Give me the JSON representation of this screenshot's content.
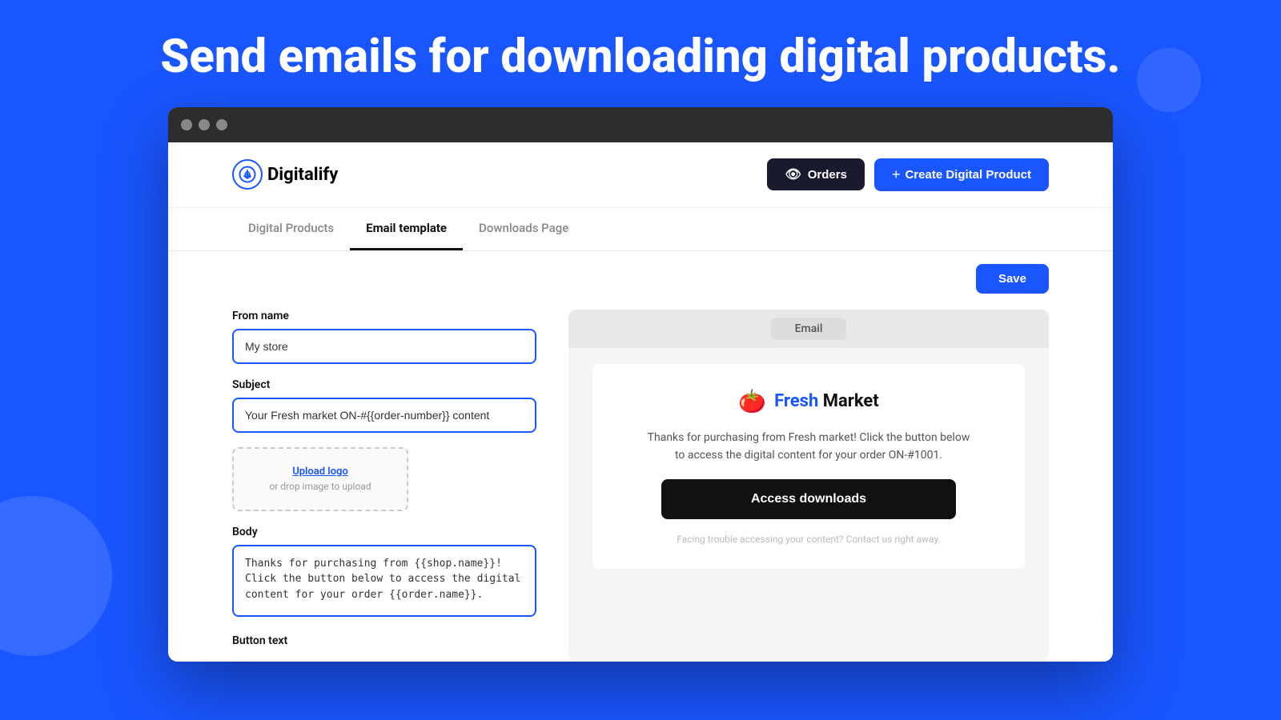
{
  "page": {
    "headline": "Send emails for downloading digital products."
  },
  "browser": {
    "dots": [
      "dot1",
      "dot2",
      "dot3"
    ]
  },
  "header": {
    "logo_text_bold": "Digital",
    "logo_text_light": "ify",
    "orders_button": "Orders",
    "create_button": "Create Digital Product"
  },
  "tabs": [
    {
      "id": "digital-products",
      "label": "Digital Products",
      "active": false
    },
    {
      "id": "email-template",
      "label": "Email template",
      "active": true
    },
    {
      "id": "downloads-page",
      "label": "Downloads Page",
      "active": false
    }
  ],
  "save_button": "Save",
  "form": {
    "from_name_label": "From name",
    "from_name_value": "My store",
    "from_name_placeholder": "My store",
    "subject_label": "Subject",
    "subject_value": "Your Fresh market ON-#{{order-number}} content",
    "subject_placeholder": "Your Fresh market ON-#{{order-number}} content",
    "upload_link": "Upload logo",
    "upload_hint": "or drop image to upload",
    "body_label": "Body",
    "body_value": "Thanks for purchasing from {{shop.name}}! Click the button below to access the digital content for your order {{order.name}}.",
    "button_text_label": "Button text"
  },
  "preview": {
    "tab_label": "Email",
    "brand_name_fresh": "Fresh",
    "brand_name_market": " Market",
    "body_text": "Thanks for purchasing from Fresh market! Click the button below\nto access the digital content for your order ON-#1001.",
    "access_button": "Access downloads",
    "trouble_text": "Facing trouble accessing your content? Contact us right away."
  }
}
